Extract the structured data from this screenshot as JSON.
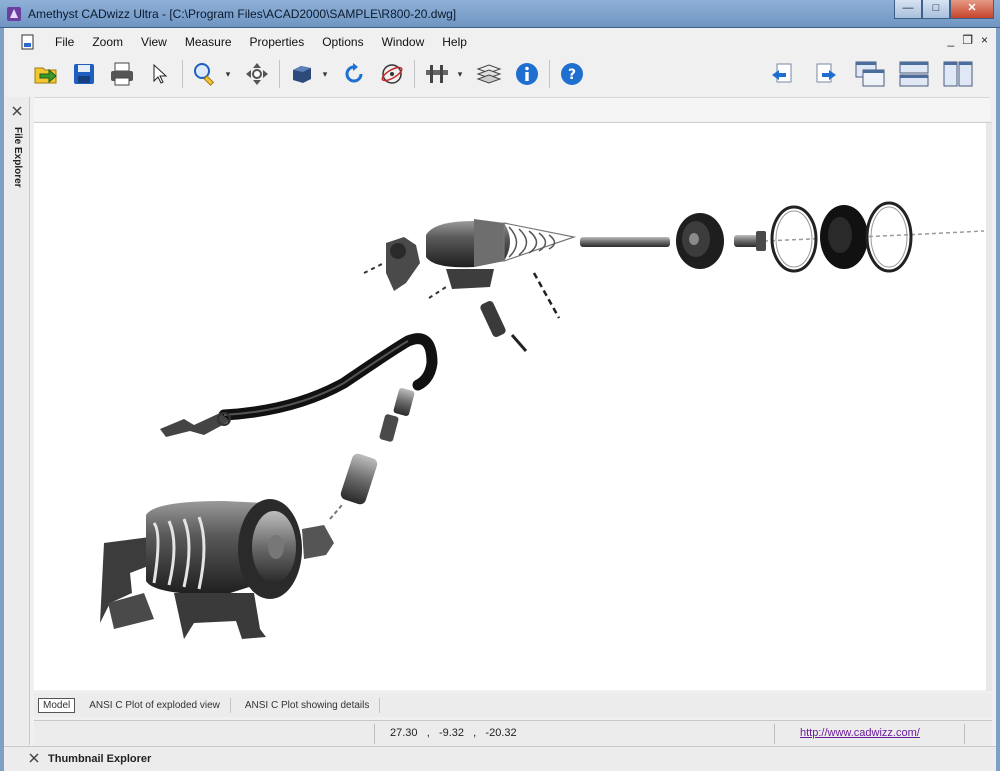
{
  "window": {
    "title": "Amethyst CADwizz Ultra - [C:\\Program Files\\ACAD2000\\SAMPLE\\R800-20.dwg]",
    "minimize": "—",
    "maximize": "□",
    "close": "✕"
  },
  "menubar": {
    "items": [
      "File",
      "Zoom",
      "View",
      "Measure",
      "Properties",
      "Options",
      "Window",
      "Help"
    ],
    "mdi": {
      "minimize": "_",
      "restore": "❐",
      "close": "×"
    }
  },
  "toolbar": {
    "icons": [
      "open-icon",
      "save-icon",
      "print-icon",
      "select-arrow-icon",
      "zoom-icon",
      "pan-icon",
      "3d-box-icon",
      "rotate-icon",
      "orbit-icon",
      "dimension-icon",
      "layers-icon",
      "info-icon",
      "help-icon"
    ],
    "right_icons": [
      "previous-view-icon",
      "next-view-icon",
      "cascade-windows-icon",
      "tile-horizontal-icon",
      "tile-vertical-icon"
    ],
    "colors": {
      "blue": "#1f6fd1",
      "green": "#3b9a2e",
      "yellow": "#f2c531"
    }
  },
  "side_panel": {
    "label": "File Explorer"
  },
  "tabs": [
    {
      "label": "Model",
      "active": true
    },
    {
      "label": "ANSI C Plot of exploded view",
      "active": false
    },
    {
      "label": "ANSI C Plot showing details",
      "active": false
    }
  ],
  "status": {
    "x": "27.30",
    "y": "-9.32",
    "z": "-20.32",
    "url": "http://www.cadwizz.com/"
  },
  "thumbnail_explorer": {
    "label": "Thumbnail Explorer"
  }
}
